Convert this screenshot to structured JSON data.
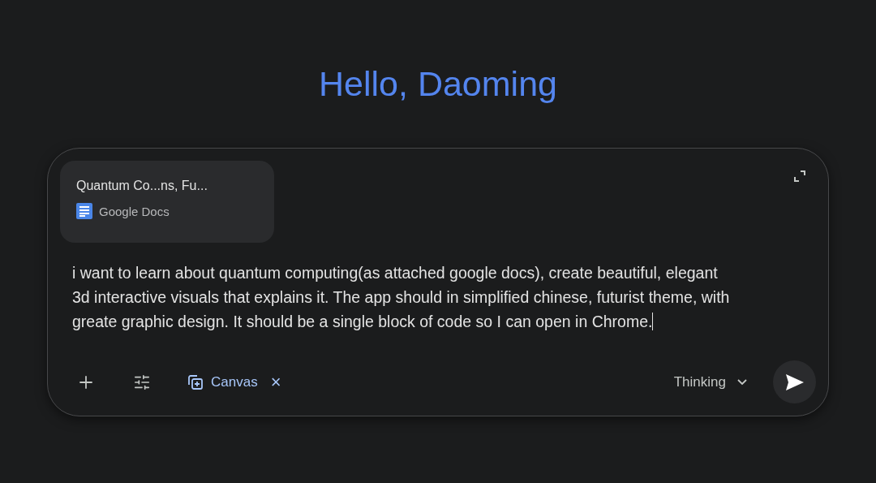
{
  "greeting": "Hello, Daoming",
  "attachment": {
    "title": "Quantum Co...ns, Fu...",
    "source": "Google Docs"
  },
  "prompt": {
    "lines": [
      "i want to learn about quantum computing(as attached google docs), create beautiful, elegant",
      "3d interactive visuals that explains it. The app should in simplified chinese, futurist theme, with",
      "greate graphic design. It should be a single block of code so I can open in Chrome."
    ]
  },
  "tool": {
    "label": "Canvas",
    "remove": "×",
    "active": true
  },
  "model": {
    "label": "Thinking"
  }
}
